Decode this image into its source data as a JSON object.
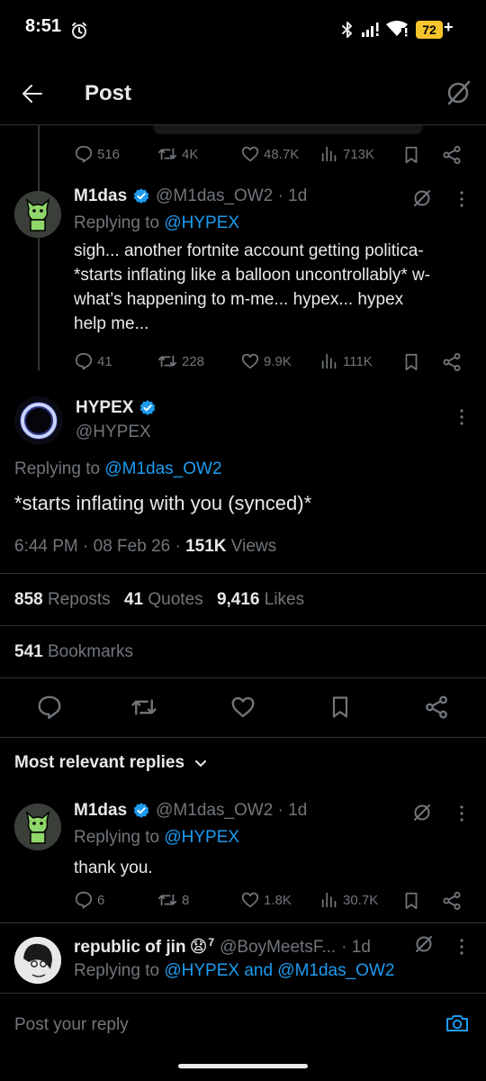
{
  "status_bar": {
    "time": "8:51",
    "battery": "72",
    "battery_suffix": "+"
  },
  "header": {
    "title": "Post"
  },
  "parent_post_actions": {
    "replies": "516",
    "reposts": "4K",
    "likes": "48.7K",
    "views": "713K"
  },
  "reply1": {
    "name": "M1das",
    "handle": "@M1das_OW2 · 1d",
    "replying_label": "Replying to",
    "replying_to": "@HYPEX",
    "text": "sigh... another fortnite account getting politica- *starts inflating like a balloon uncontrollably* w-what’s happening to m-me... hypex... hypex help me...",
    "replies": "41",
    "reposts": "228",
    "likes": "9.9K",
    "views": "111K"
  },
  "main_post": {
    "name": "HYPEX",
    "handle": "@HYPEX",
    "replying_label": "Replying to",
    "replying_to": "@M1das_OW2",
    "text": "*starts inflating with you (synced)*",
    "timestamp": "6:44 PM · 08 Feb 26 · ",
    "views_count": "151K",
    "views_label": " Views",
    "reposts_count": "858",
    "reposts_label": " Reposts",
    "quotes_count": "41",
    "quotes_label": " Quotes",
    "likes_count": "9,416",
    "likes_label": " Likes",
    "bookmarks_count": "541",
    "bookmarks_label": " Bookmarks"
  },
  "replies_section": {
    "sort_label": "Most relevant replies"
  },
  "reply2": {
    "name": "M1das",
    "handle": "@M1das_OW2 · 1d",
    "replying_label": "Replying to",
    "replying_to": "@HYPEX",
    "text": "thank you.",
    "replies": "6",
    "reposts": "8",
    "likes": "1.8K",
    "views": "30.7K"
  },
  "reply3": {
    "name": "republic of jin",
    "emoji": "😧",
    "superscript": "7",
    "handle": "@BoyMeetsF...",
    "time": " · 1d",
    "replying_label": "Replying to",
    "replying_to": "@HYPEX and @M1das_OW2"
  },
  "composer": {
    "placeholder": "Post your reply"
  },
  "colors": {
    "background": "#000000",
    "accent": "#1d9bf0",
    "muted": "#71767b",
    "text": "#e7e9ea",
    "battery": "#f5c32c"
  }
}
